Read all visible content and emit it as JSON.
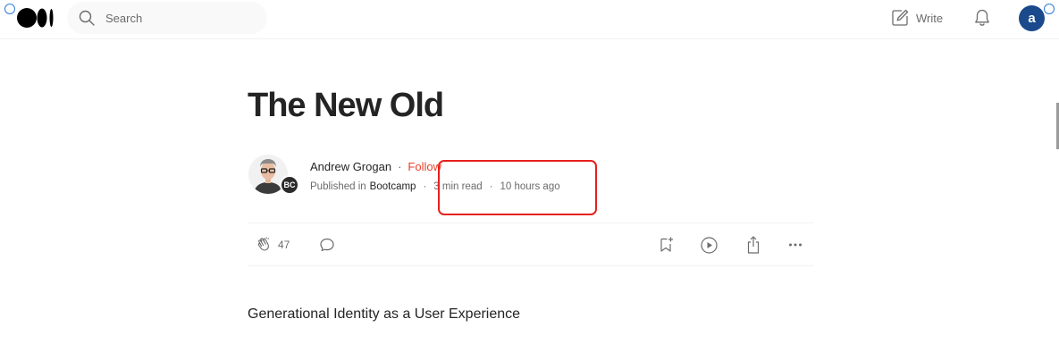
{
  "header": {
    "search_placeholder": "Search",
    "write_label": "Write",
    "avatar_initial": "a"
  },
  "article": {
    "title": "The New Old",
    "author_name": "Andrew Grogan",
    "separator": "·",
    "follow_label": "Follow",
    "published_in_label": "Published in",
    "publication_name": "Bootcamp",
    "publication_badge_text": "BC",
    "read_time": "3 min read",
    "posted_time": "10 hours ago",
    "clap_count": "47",
    "subtitle": "Generational Identity as a User Experience"
  },
  "icons": {
    "logo": "medium-logo-icon",
    "search": "search-icon",
    "write": "pencil-square-icon",
    "notifications": "bell-icon",
    "clap": "clap-icon",
    "comment": "comment-bubble-icon",
    "save": "bookmark-plus-icon",
    "listen": "play-circle-icon",
    "share": "share-icon",
    "more": "ellipsis-icon"
  },
  "colors": {
    "follow": "#e8412b",
    "highlight": "#e5201d",
    "avatar_bg": "#1a4a8c",
    "text_primary": "#242424",
    "text_secondary": "#6b6b6b"
  }
}
